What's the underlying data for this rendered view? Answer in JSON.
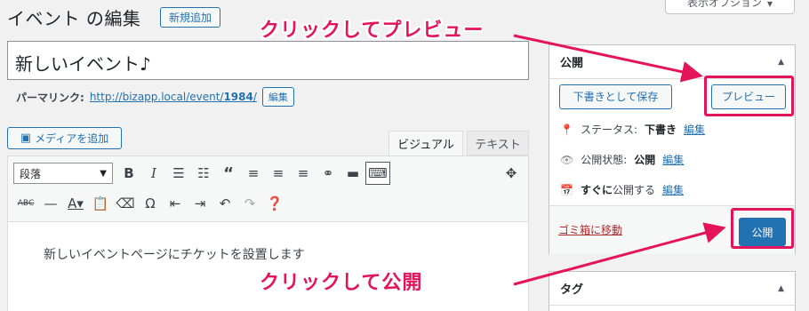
{
  "header": {
    "page_title": "イベント の編集",
    "add_new_label": "新規追加",
    "screen_options_label": "表示オプション"
  },
  "editor": {
    "title_value": "新しいイベント♪",
    "permalink_label": "パーマリンク:",
    "permalink_url_prefix": "http://bizapp.local/event/",
    "permalink_slug": "1984",
    "permalink_url_suffix": "/",
    "permalink_edit_label": "編集",
    "add_media_label": "メディアを追加",
    "tab_visual": "ビジュアル",
    "tab_text": "テキスト",
    "format_select_value": "段落",
    "format_icons_row1": [
      "B",
      "I",
      "•≡",
      "1≡",
      "“",
      "≡",
      "≡",
      "≡",
      "🔗",
      "▬",
      "⌨"
    ],
    "body_text": "新しいイベントページにチケットを設置します"
  },
  "publish_box": {
    "title": "公開",
    "save_draft_label": "下書きとして保存",
    "preview_label": "プレビュー",
    "status_label": "ステータス:",
    "status_value": "下書き",
    "visibility_label": "公開状態:",
    "visibility_value": "公開",
    "schedule_value": "すぐに",
    "schedule_label": "公開する",
    "edit_link": "編集",
    "trash_label": "ゴミ箱に移動",
    "publish_label": "公開"
  },
  "tag_box": {
    "title": "タグ"
  },
  "annotations": {
    "preview_note": "クリックしてプレビュー",
    "publish_note": "クリックして公開",
    "color": "#e4145b"
  }
}
